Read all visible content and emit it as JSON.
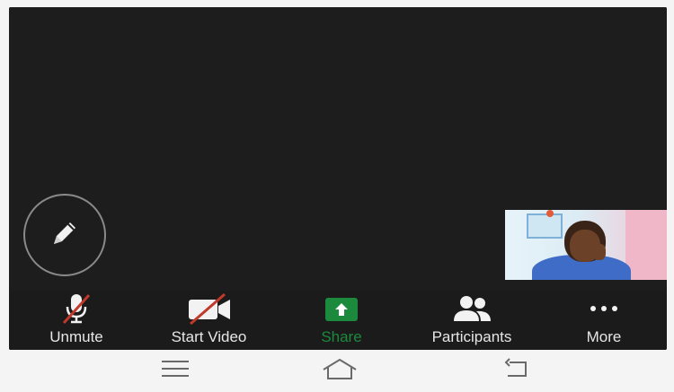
{
  "toolbar": {
    "unmute_label": "Unmute",
    "start_video_label": "Start Video",
    "share_label": "Share",
    "participants_label": "Participants",
    "more_label": "More"
  },
  "colors": {
    "background": "#1c1c1c",
    "share_accent": "#1b8a3c",
    "mute_slash": "#c0392b",
    "notification": "#e2622f"
  },
  "icons": [
    "pencil-icon",
    "microphone-muted-icon",
    "camera-off-icon",
    "share-up-arrow-icon",
    "participants-icon",
    "more-dots-icon",
    "menu-icon",
    "home-icon",
    "back-icon"
  ]
}
